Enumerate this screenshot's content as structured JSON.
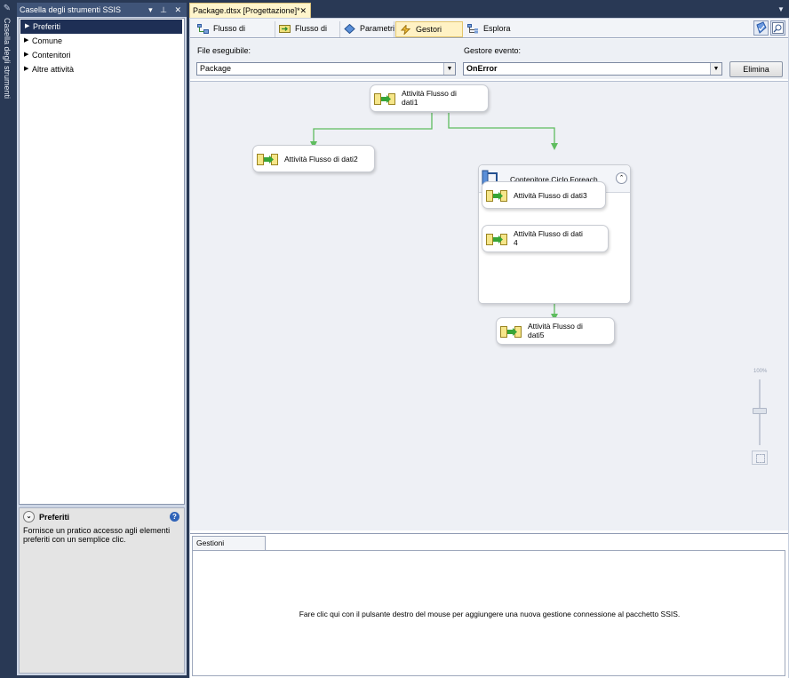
{
  "vertical_strip": {
    "label": "Casella degli strumenti"
  },
  "toolbox": {
    "title": "Casella degli strumenti SSIS",
    "title_icons": "▾ ⊥ ✕",
    "items": [
      {
        "label": "Preferiti",
        "selected": true
      },
      {
        "label": "Comune"
      },
      {
        "label": "Contenitori"
      },
      {
        "label": "Altre attività"
      }
    ],
    "info": {
      "title": "Preferiti",
      "description": "Fornisce un pratico accesso agli elementi preferiti con un semplice clic."
    }
  },
  "document": {
    "tab_title": "Package.dtsx [Progettazione]*",
    "tab_close": "✕"
  },
  "designer_tabs": [
    {
      "label": "Flusso di controllo"
    },
    {
      "label": "Flusso di dati"
    },
    {
      "label": "Parametri"
    },
    {
      "label": "Gestori eventi",
      "active": true
    },
    {
      "label": "Esplora pacchetti"
    }
  ],
  "event_handler_bar": {
    "executable_label": "File eseguibile:",
    "executable_value": "Package",
    "event_label": "Gestore evento:",
    "event_value": "OnError",
    "delete_button": "Elimina"
  },
  "canvas": {
    "tasks": [
      {
        "id": "t1",
        "line1": "Attività Flusso di",
        "line2": "dati1"
      },
      {
        "id": "t2",
        "line1": "Attività Flusso di dati2",
        "line2": ""
      },
      {
        "id": "t3",
        "line1": "Attività Flusso di dati3",
        "line2": ""
      },
      {
        "id": "t4",
        "line1": "Attività Flusso di dati",
        "line2": "4"
      },
      {
        "id": "t5",
        "line1": "Attività Flusso di",
        "line2": "dati5"
      }
    ],
    "container": {
      "label": "Contenitore Ciclo Foreach",
      "collapse_glyph": "⌃"
    },
    "zoom": {
      "label": "100%",
      "level": 1.0
    }
  },
  "connection_managers": {
    "tab_label": "Gestioni connessioni",
    "hint": "Fare clic qui con il pulsante destro del mouse per aggiungere una nuova gestione connessione al pacchetto SSIS."
  },
  "colors": {
    "connector_green": "#5fbd5f",
    "active_tab": "#fff2c4",
    "toolbox_selected": "#1e2f55",
    "frame": "#293955"
  }
}
